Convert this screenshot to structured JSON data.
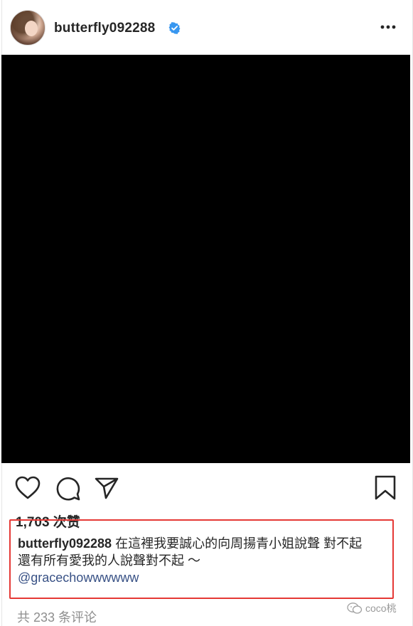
{
  "post": {
    "username": "butterfly092288",
    "verified": true,
    "likes_text": "1,703 次赞",
    "caption": {
      "username": "butterfly092288",
      "text_line1": "在這裡我要誠心的向周揚青小姐說聲 對不起",
      "text_line2": "還有所有愛我的人說聲對不起 ～",
      "mention": "@gracechowwwwww"
    },
    "comments_text": "共 233 条评论"
  },
  "icons": {
    "header": [
      "avatar",
      "verified-badge-icon",
      "more-options-icon"
    ],
    "actions": [
      "heart-icon",
      "comment-icon",
      "share-icon",
      "bookmark-icon"
    ]
  },
  "watermark": {
    "text": "coco桃"
  },
  "colors": {
    "highlight_box": "#e53935",
    "verified": "#3897f0",
    "mention": "#385185",
    "muted": "#8e8e8e"
  }
}
